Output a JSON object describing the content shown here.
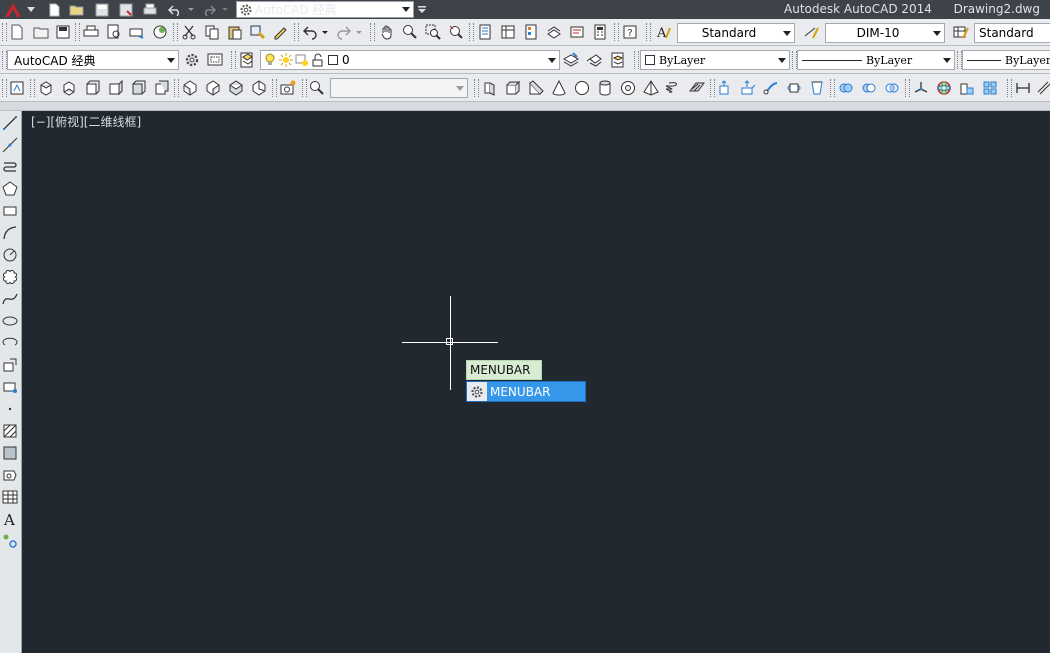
{
  "titlebar": {
    "app_title": "Autodesk AutoCAD 2014",
    "file_name": "Drawing2.dwg",
    "workspace": "AutoCAD 经典"
  },
  "toolbar_styles": {
    "text_style": "Standard",
    "dim_style": "DIM-10",
    "table_style": "Standard"
  },
  "toolbar_layers": {
    "workspace": "AutoCAD 经典",
    "layer": "0",
    "color": "ByLayer",
    "linetype": "ByLayer",
    "lineweight": "ByLayer"
  },
  "toolbar_3d": {
    "view_combo": ""
  },
  "canvas": {
    "view_label": "[−][俯视][二维线框]"
  },
  "autocomplete": {
    "typed": "MENUBAR",
    "suggestion": "MENUBAR"
  },
  "colors": {
    "canvas_bg": "#212830",
    "titlebar_bg": "#3e4349",
    "toolbar_bg": "#e9ebee",
    "highlight": "#3597e9",
    "autocomplete_input": "#d8ecd4",
    "logo_red": "#c8262c"
  }
}
